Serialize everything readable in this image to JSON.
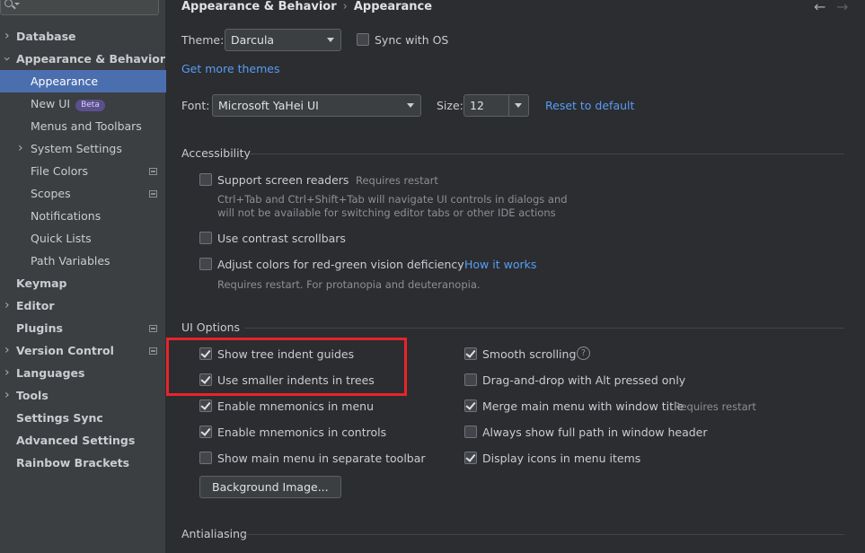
{
  "sidebar": {
    "items": [
      {
        "label": "Database"
      },
      {
        "label": "Appearance & Behavior"
      },
      {
        "label": "Appearance"
      },
      {
        "label": "New UI",
        "badge": "Beta"
      },
      {
        "label": "Menus and Toolbars"
      },
      {
        "label": "System Settings"
      },
      {
        "label": "File Colors"
      },
      {
        "label": "Scopes"
      },
      {
        "label": "Notifications"
      },
      {
        "label": "Quick Lists"
      },
      {
        "label": "Path Variables"
      },
      {
        "label": "Keymap"
      },
      {
        "label": "Editor"
      },
      {
        "label": "Plugins"
      },
      {
        "label": "Version Control"
      },
      {
        "label": "Languages"
      },
      {
        "label": "Tools"
      },
      {
        "label": "Settings Sync"
      },
      {
        "label": "Advanced Settings"
      },
      {
        "label": "Rainbow Brackets"
      }
    ]
  },
  "header": {
    "breadcrumb_parent": "Appearance & Behavior",
    "breadcrumb_separator": "›",
    "breadcrumb_current": "Appearance",
    "back_arrow": "←",
    "forward_arrow": "→"
  },
  "theme": {
    "label": "Theme:",
    "value": "Darcula",
    "sync_label": "Sync with OS",
    "sync_checked": false,
    "more_themes_link": "Get more themes"
  },
  "font": {
    "label": "Font:",
    "value": "Microsoft YaHei UI",
    "size_label": "Size:",
    "size_value": "12",
    "reset_link": "Reset to default"
  },
  "accessibility": {
    "title": "Accessibility",
    "screen_readers": {
      "label": "Support screen readers",
      "hint": "Requires restart",
      "desc_line1": "Ctrl+Tab and Ctrl+Shift+Tab will navigate UI controls in dialogs and",
      "desc_line2": "will not be available for switching editor tabs or other IDE actions",
      "checked": false
    },
    "contrast_scrollbars": {
      "label": "Use contrast scrollbars",
      "checked": false
    },
    "color_deficiency": {
      "label": "Adjust colors for red-green vision deficiency",
      "link": "How it works",
      "desc": "Requires restart. For protanopia and deuteranopia.",
      "checked": false
    }
  },
  "ui_options": {
    "title": "UI Options",
    "left": [
      {
        "label": "Show tree indent guides",
        "checked": true
      },
      {
        "label": "Use smaller indents in trees",
        "checked": true
      },
      {
        "label": "Enable mnemonics in menu",
        "checked": true
      },
      {
        "label": "Enable mnemonics in controls",
        "checked": true
      },
      {
        "label": "Show main menu in separate toolbar",
        "checked": false
      }
    ],
    "right": [
      {
        "label": "Smooth scrolling",
        "checked": true
      },
      {
        "label": "Drag-and-drop with Alt pressed only",
        "checked": false
      },
      {
        "label": "Merge main menu with window title",
        "hint": "Requires restart",
        "checked": true
      },
      {
        "label": "Always show full path in window header",
        "checked": false
      },
      {
        "label": "Display icons in menu items",
        "checked": true
      }
    ],
    "help_glyph": "?",
    "background_button": "Background Image..."
  },
  "antialiasing": {
    "title": "Antialiasing"
  },
  "colors": {
    "accent_selection": "#4b6eaf",
    "link": "#589df6",
    "highlight_box": "#e8242b"
  }
}
